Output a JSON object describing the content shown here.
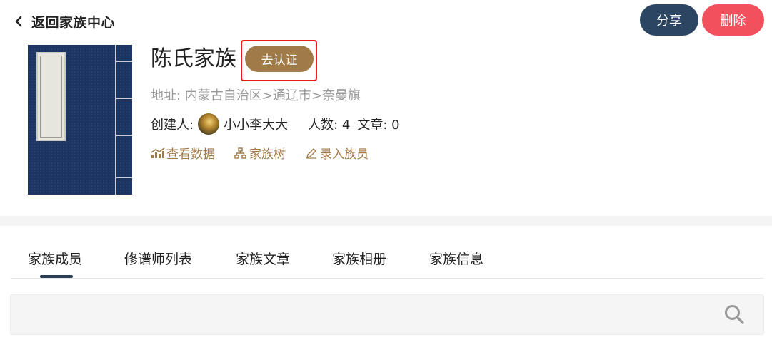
{
  "header": {
    "back_label": "返回家族中心",
    "share_label": "分享",
    "delete_label": "删除"
  },
  "family": {
    "name": "陈氏家族",
    "certify_label": "去认证",
    "address": "地址: 内蒙古自治区>通辽市>奈曼旗",
    "creator_label": "创建人:",
    "creator_name": "小小李大大",
    "people_label": "人数: 4",
    "articles_label": "文章: 0"
  },
  "actions": [
    {
      "label": "查看数据",
      "icon": "chart-icon"
    },
    {
      "label": "家族树",
      "icon": "tree-icon"
    },
    {
      "label": "录入族员",
      "icon": "pen-icon"
    }
  ],
  "tabs": [
    {
      "label": "家族成员",
      "active": true
    },
    {
      "label": "修谱师列表",
      "active": false
    },
    {
      "label": "家族文章",
      "active": false
    },
    {
      "label": "家族相册",
      "active": false
    },
    {
      "label": "家族信息",
      "active": false
    }
  ],
  "search": {
    "icon": "search-icon"
  },
  "colors": {
    "navy": "#2b4562",
    "danger": "#f1505c",
    "gold": "#a07a47",
    "highlight_red": "#ea1b1b",
    "cover_blue": "#1b3461"
  }
}
